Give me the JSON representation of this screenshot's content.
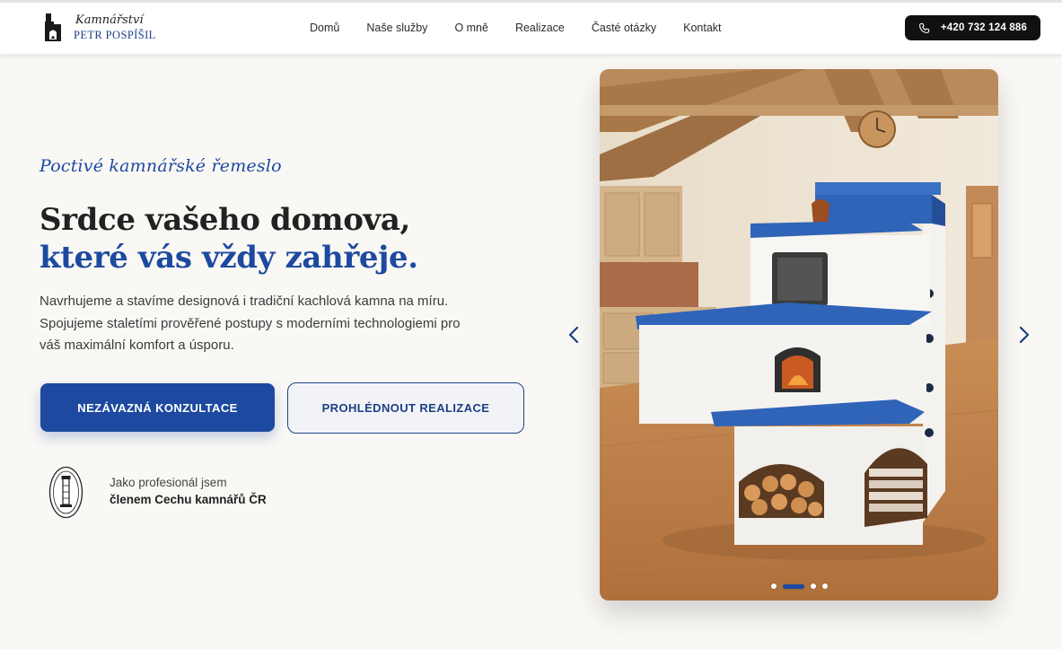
{
  "brand": {
    "script_line": "Kamnářství",
    "name_line": "PETR POSPÍŠIL"
  },
  "nav": {
    "items": [
      {
        "label": "Domů"
      },
      {
        "label": "Naše služby"
      },
      {
        "label": "O mně"
      },
      {
        "label": "Realizace"
      },
      {
        "label": "Časté otázky"
      },
      {
        "label": "Kontakt"
      }
    ]
  },
  "phone": {
    "label": "+420 732 124 886",
    "icon": "phone-icon"
  },
  "hero": {
    "tagline": "Poctivé kamnářské řemeslo",
    "headline_line1": "Srdce vašeho domova,",
    "headline_line2": "které vás vždy zahřeje.",
    "lead": "Navrhujeme a stavíme designová i tradiční kachlová kamna na míru. Spojujeme staletími prověřené postupy s moderními technologiemi pro váš maximální komfort a úsporu.",
    "cta_primary": "NEZÁVAZNÁ KONZULTACE",
    "cta_secondary": "PROHLÉDNOUT REALIZACE"
  },
  "guild": {
    "line1": "Jako profesionál jsem",
    "line2": "členem Cechu kamnářů ČR",
    "seal_text": "CECH KAMNÁŘŮ ČESKÉ REPUBLIKY · 1997"
  },
  "slider": {
    "slide_count": 4,
    "active_index": 1,
    "prev_icon": "chevron-left-icon",
    "next_icon": "chevron-right-icon"
  },
  "colors": {
    "accent": "#1d4aa0",
    "dark": "#111111",
    "background": "#faf8f5"
  }
}
